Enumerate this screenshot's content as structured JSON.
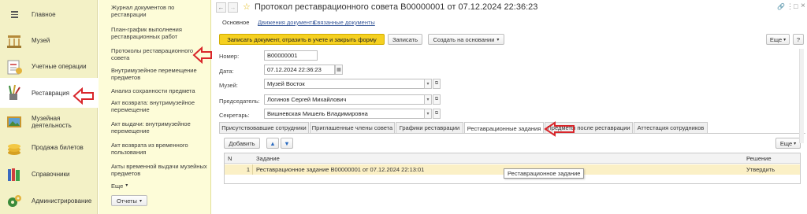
{
  "nav": {
    "items": [
      {
        "label": "Главное",
        "icon": "menu-icon"
      },
      {
        "label": "Музей",
        "icon": "museum-icon"
      },
      {
        "label": "Учетные операции",
        "icon": "ledger-icon"
      },
      {
        "label": "Реставрация",
        "icon": "brush-icon"
      },
      {
        "label": "Музейная деятельность",
        "icon": "painting-icon"
      },
      {
        "label": "Продажа билетов",
        "icon": "coins-icon"
      },
      {
        "label": "Справочники",
        "icon": "books-icon"
      },
      {
        "label": "Администрирование",
        "icon": "gears-icon"
      }
    ]
  },
  "submenu": {
    "links": [
      "Журнал документов по реставрации",
      "План-график выполнения реставрационных работ",
      "Протоколы реставрационного совета",
      "Внутримузейное перемещение предметов",
      "Анализ сохранности предмета",
      "Акт возврата: внутримузейное перемещение",
      "Акт выдачи: внутримузейное перемещение",
      "Акт возврата из временного пользования",
      "Акты временной выдачи музейных предметов"
    ],
    "more": "Еще",
    "reports": "Отчеты"
  },
  "window": {
    "title": "Протокол реставрационного совета B00000001 от 07.12.2024 22:36:23",
    "tabs": [
      "Основное",
      "Движения документа",
      "Связанные документы"
    ]
  },
  "toolbar": {
    "post_close": "Записать документ, отразить в учете и закрыть форму",
    "save": "Записать",
    "create_based": "Создать на основании",
    "more": "Еще",
    "help": "?"
  },
  "form": {
    "number_label": "Номер:",
    "number_value": "B00000001",
    "date_label": "Дата:",
    "date_value": "07.12.2024 22:36:23",
    "museum_label": "Музей:",
    "museum_value": "Музей Восток",
    "chair_label": "Председатель:",
    "chair_value": "Логинов Сергей Михайлович",
    "secretary_label": "Секретарь:",
    "secretary_value": "Вишневская Мишель Владимировна"
  },
  "section_tabs": [
    "Присутствовавшие сотрудники",
    "Приглашенные члены совета",
    "Графики реставрации",
    "Реставрационные задания",
    "Предметы после реставрации",
    "Аттестация сотрудников"
  ],
  "table": {
    "add": "Добавить",
    "more": "Еще",
    "headers": {
      "n": "N",
      "task": "Задание",
      "decision": "Решение"
    },
    "rows": [
      {
        "n": "1",
        "task": "Реставрационное задание B00000001 от 07.12.2024 22:13:01",
        "decision": "Утвердить"
      }
    ],
    "tooltip": "Реставрационное задание"
  },
  "colors": {
    "nav_bg": "#f3f1c6",
    "submenu_bg": "#fdfcd8",
    "primary_button": "#f5d020",
    "selected_row": "#fbf0c6",
    "annotation_arrow": "#d9262b"
  }
}
